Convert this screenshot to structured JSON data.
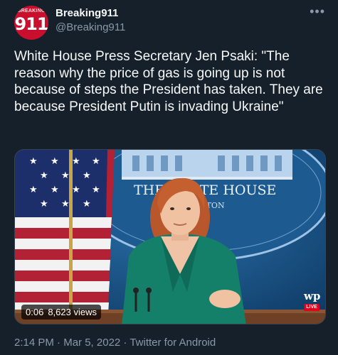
{
  "account": {
    "avatar_top_text": "BREAKING",
    "avatar_big_text": "911",
    "display_name": "Breaking911",
    "handle": "@Breaking911"
  },
  "more_icon": "more-options-icon",
  "tweet": {
    "text": "White House Press Secretary Jen Psaki: \"The reason why the price of gas is going up is not because of steps the President has taken. They are because President Putin is invading Ukraine\""
  },
  "media": {
    "seal_line1": "THE WHITE HOUSE",
    "seal_line2": "WASHINGTON",
    "video_time": "0:06",
    "video_views": "8,623 views",
    "logo_mark": "wp",
    "logo_live": "LIVE"
  },
  "meta": {
    "time": "2:14 PM",
    "separator": " · ",
    "date": "Mar 5, 2022",
    "source": "Twitter for Android"
  },
  "colors": {
    "background": "#15202b",
    "text": "#f7f9f9",
    "muted": "#8b98a5",
    "avatar_red": "#c8102e"
  }
}
